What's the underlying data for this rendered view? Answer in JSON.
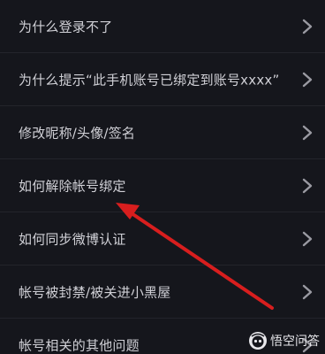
{
  "menu": {
    "items": [
      {
        "label": "为什么登录不了"
      },
      {
        "label": "为什么提示“此手机账号已绑定到账号xxxx”"
      },
      {
        "label": "修改昵称/头像/签名"
      },
      {
        "label": "如何解除帐号绑定"
      },
      {
        "label": "如何同步微博认证"
      },
      {
        "label": "帐号被封禁/被关进小黑屋"
      },
      {
        "label": "帐号相关的其他问题"
      }
    ]
  },
  "watermark": {
    "text": "悟空问答",
    "icon": "wukong-logo-icon"
  },
  "annotation": {
    "arrow_color": "#d81e1e",
    "points_to": "如何解除帐号绑定"
  },
  "colors": {
    "background": "#15161c",
    "text": "#d0d0d6",
    "chevron": "#9a9aa2"
  }
}
